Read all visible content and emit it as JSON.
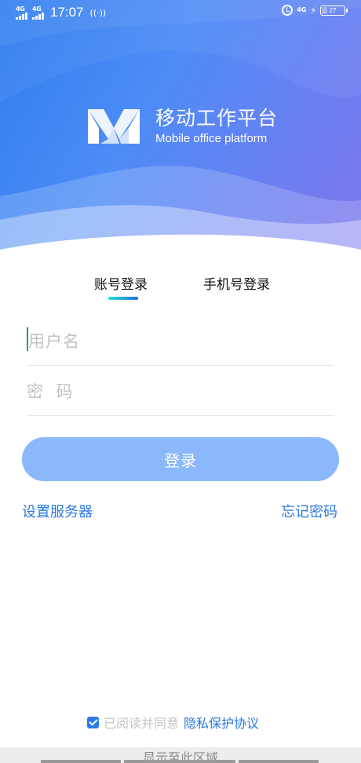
{
  "status_bar": {
    "network_left_1": "4G",
    "network_left_2": "4G",
    "time": "17:07",
    "network_right": "4G",
    "battery": "27",
    "battery_level": 0.27,
    "icons": [
      "signal-icon",
      "signal-icon",
      "hotspot-icon",
      "alarm-icon",
      "charging-icon",
      "battery-icon"
    ]
  },
  "brand": {
    "title": "移动工作平台",
    "subtitle": "Mobile office platform",
    "logo_icon": "m-logo-icon"
  },
  "tabs": [
    {
      "label": "账号登录",
      "active": true
    },
    {
      "label": "手机号登录",
      "active": false
    }
  ],
  "form": {
    "username_placeholder": "用户名",
    "password_placeholder": "密  码",
    "username_value": "",
    "password_value": "",
    "login_label": "登录"
  },
  "links": {
    "server_settings": "设置服务器",
    "forgot_password": "忘记密码"
  },
  "agreement": {
    "checked": true,
    "text": "已阅读并同意",
    "link": "隐私保护协议"
  },
  "footer": {
    "text": "显示至此区域"
  },
  "colors": {
    "gradient_start": "#2f7cf0",
    "gradient_end": "#7d76ec",
    "primary_button": "#8ab8fb",
    "link": "#2a78e0",
    "tab_indicator_start": "#2ee0d0",
    "tab_indicator_end": "#1f6fe8"
  }
}
